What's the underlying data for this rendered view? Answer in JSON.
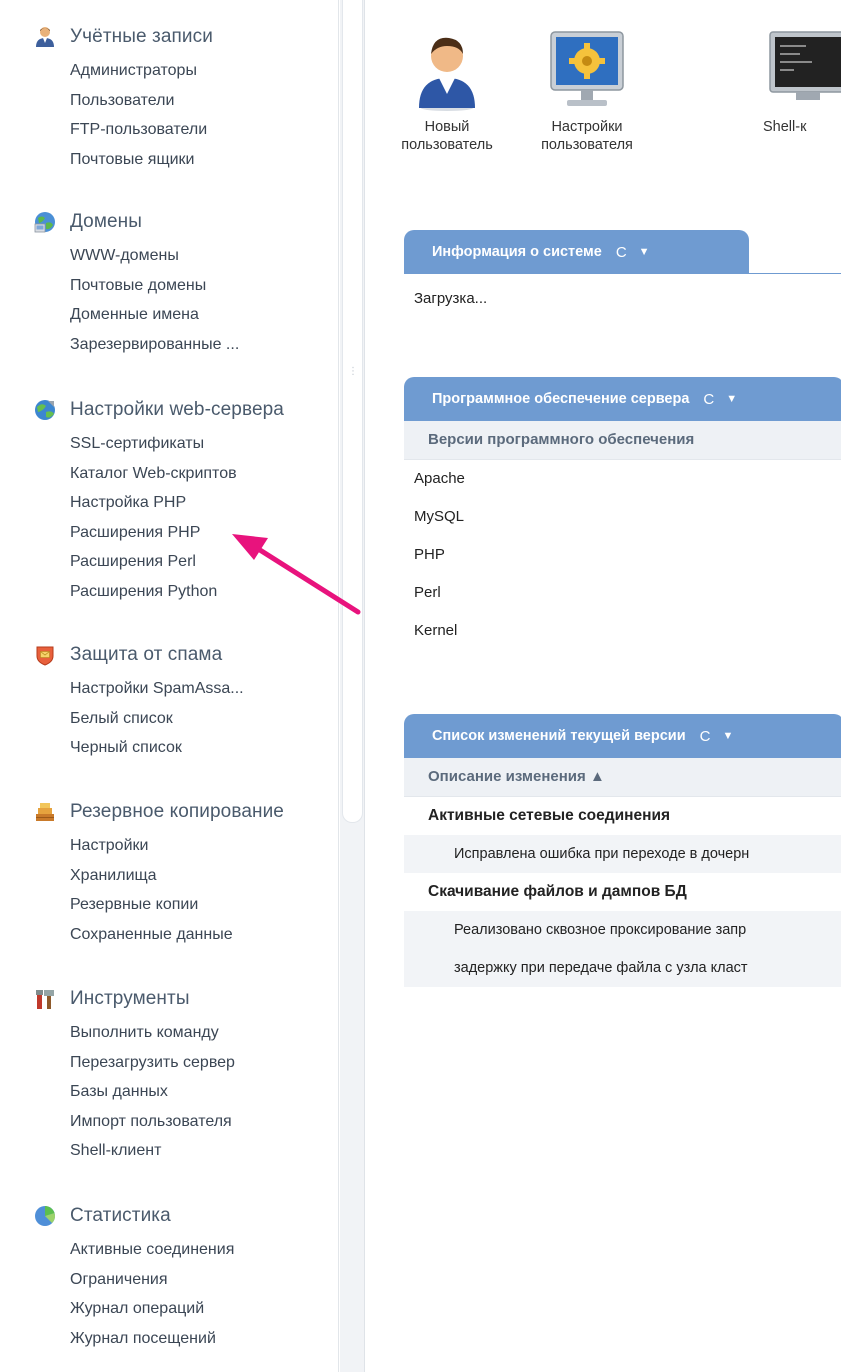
{
  "colors": {
    "accent": "#6f9bd1",
    "arrow": "#e8137d",
    "sidebar_text": "#3b4654",
    "group_title": "#4a5a6c"
  },
  "sidebar": {
    "groups": [
      {
        "title": "Учётные записи",
        "icon": "users-icon",
        "items": [
          "Администраторы",
          "Пользователи",
          "FTP-пользователи",
          "Почтовые ящики"
        ]
      },
      {
        "title": "Домены",
        "icon": "globe-icon",
        "items": [
          "WWW-домены",
          "Почтовые домены",
          "Доменные имена",
          "Зарезервированные ..."
        ]
      },
      {
        "title": "Настройки web-сервера",
        "icon": "web-server-icon",
        "items": [
          "SSL-сертификаты",
          "Каталог Web-скриптов",
          "Настройка PHP",
          "Расширения PHP",
          "Расширения Perl",
          "Расширения Python"
        ]
      },
      {
        "title": "Защита от спама",
        "icon": "shield-icon",
        "items": [
          "Настройки SpamAssa...",
          "Белый список",
          "Черный список"
        ]
      },
      {
        "title": "Резервное копирование",
        "icon": "backup-icon",
        "items": [
          "Настройки",
          "Хранилища",
          "Резервные копии",
          "Сохраненные данные"
        ]
      },
      {
        "title": "Инструменты",
        "icon": "tools-icon",
        "items": [
          "Выполнить команду",
          "Перезагрузить сервер",
          "Базы данных",
          "Импорт пользователя",
          "Shell-клиент"
        ]
      },
      {
        "title": "Статистика",
        "icon": "pie-chart-icon",
        "items": [
          "Активные соединения",
          "Ограничения",
          "Журнал операций",
          "Журнал посещений"
        ]
      }
    ]
  },
  "toolbar": {
    "new_user": [
      "Новый",
      "пользователь"
    ],
    "user_settings": [
      "Настройки",
      "пользователя"
    ],
    "shell": "Shell-к"
  },
  "panels": {
    "system_info": {
      "title": "Информация о системе",
      "body": "Загрузка..."
    },
    "software": {
      "title": "Программное обеспечение сервера",
      "subhead": "Версии программного обеспечения",
      "rows": [
        "Apache",
        "MySQL",
        "PHP",
        "Perl",
        "Kernel"
      ]
    },
    "changelog": {
      "title": "Список изменений текущей версии",
      "subhead": "Описание изменения ▲",
      "groups": [
        {
          "title": "Активные сетевые соединения",
          "items": [
            "Исправлена ошибка при переходе в дочерн"
          ]
        },
        {
          "title": "Скачивание файлов и дампов БД",
          "items": [
            "Реализовано сквозное проксирование запр",
            "задержку при передаче файла с узла класт"
          ]
        }
      ]
    }
  },
  "panel_controls": {
    "refresh": "C",
    "menu": "▼"
  }
}
